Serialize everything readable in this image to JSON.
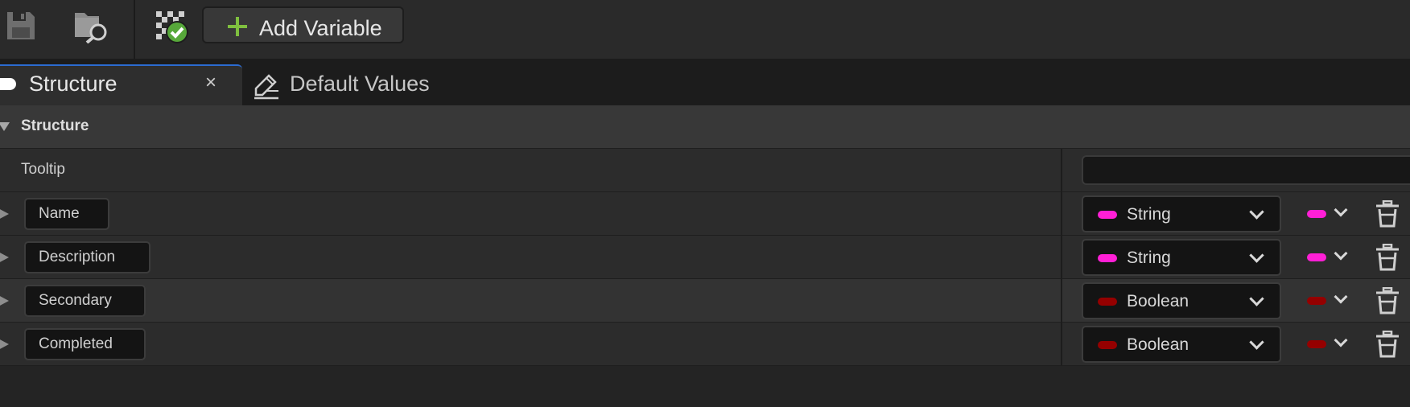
{
  "toolbar": {
    "save_icon": "save-icon",
    "browse_icon": "browse-folder-icon",
    "compile_icon": "compile-check-icon",
    "add_variable_label": "Add Variable"
  },
  "tabs": [
    {
      "label": "Structure",
      "active": true,
      "close_glyph": "×"
    },
    {
      "label": "Default Values",
      "active": false
    }
  ],
  "section": {
    "title": "Structure"
  },
  "tooltip": {
    "label": "Tooltip",
    "value": ""
  },
  "variables": [
    {
      "name": "Name",
      "type": "String",
      "color": "#ff1fd6"
    },
    {
      "name": "Description",
      "type": "String",
      "color": "#ff1fd6"
    },
    {
      "name": "Secondary",
      "type": "Boolean",
      "color": "#950000"
    },
    {
      "name": "Completed",
      "type": "Boolean",
      "color": "#950000"
    }
  ]
}
